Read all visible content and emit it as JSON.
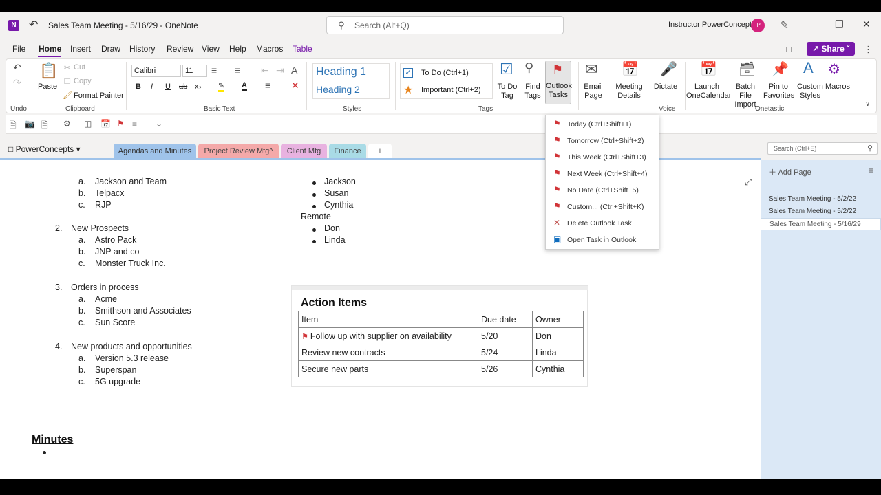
{
  "window": {
    "title": "Sales Team Meeting - 5/16/29  -  OneNote",
    "search_placeholder": "Search (Alt+Q)",
    "user_name": "Instructor PowerConcepts",
    "avatar_initials": "IP"
  },
  "menu": {
    "items": [
      "File",
      "Home",
      "Insert",
      "Draw",
      "History",
      "Review",
      "View",
      "Help",
      "Macros",
      "Table"
    ],
    "active": "Home",
    "share_label": "Share"
  },
  "ribbon": {
    "undo_group": "Undo",
    "clipboard": {
      "paste": "Paste",
      "cut": "Cut",
      "copy": "Copy",
      "format_painter": "Format Painter",
      "group": "Clipboard"
    },
    "basic_text": {
      "font": "Calibri",
      "size": "11",
      "group": "Basic Text"
    },
    "styles": {
      "heading1": "Heading 1",
      "heading2": "Heading 2",
      "group": "Styles"
    },
    "tags": {
      "todo": "To Do (Ctrl+1)",
      "important": "Important (Ctrl+2)",
      "group": "Tags",
      "todo_tag": "To Do Tag",
      "find_tags": "Find Tags",
      "outlook_tasks": "Outlook Tasks"
    },
    "email_page": "Email Page",
    "meeting_details": "Meeting Details",
    "dictate": "Dictate",
    "voice_group": "Voice",
    "onetastic": {
      "launch": "Launch OneCalendar",
      "batch": "Batch File Import",
      "pin": "Pin to Favorites",
      "custom": "Custom Styles",
      "macros": "Macros",
      "group": "Onetastic"
    }
  },
  "notebook": {
    "name": "PowerConcepts",
    "tabs": [
      "Agendas and Minutes",
      "Project Review Mtg^",
      "Client Mtg",
      "Finance",
      "+"
    ],
    "search_placeholder": "Search (Ctrl+E)"
  },
  "outlook_menu": [
    {
      "label": "Today",
      "shortcut": "(Ctrl+Shift+1)",
      "icon": "flag-icon"
    },
    {
      "label": "Tomorrow",
      "shortcut": "(Ctrl+Shift+2)",
      "icon": "flag-icon"
    },
    {
      "label": "This Week",
      "shortcut": "(Ctrl+Shift+3)",
      "icon": "flag-icon"
    },
    {
      "label": "Next Week",
      "shortcut": "(Ctrl+Shift+4)",
      "icon": "flag-icon"
    },
    {
      "label": "No Date",
      "shortcut": "(Ctrl+Shift+5)",
      "icon": "flag-icon"
    },
    {
      "label": "Custom...",
      "shortcut": "(Ctrl+Shift+K)",
      "icon": "flag-icon"
    },
    {
      "label": "Delete Outlook Task",
      "shortcut": "",
      "icon": "delete-x-icon"
    },
    {
      "label": "Open Task in Outlook",
      "shortcut": "",
      "icon": "outlook-icon"
    }
  ],
  "page": {
    "list": [
      {
        "num": "a.",
        "text": "Jackson and Team"
      },
      {
        "num": "b.",
        "text": "Telpacx"
      },
      {
        "num": "c.",
        "text": "RJP"
      },
      {
        "num": "2.",
        "text": "New Prospects"
      },
      {
        "num": "a.",
        "text": "Astro Pack"
      },
      {
        "num": "b.",
        "text": "JNP and co"
      },
      {
        "num": "c.",
        "text": "Monster Truck Inc."
      },
      {
        "num": "3.",
        "text": "Orders in process"
      },
      {
        "num": "a.",
        "text": "Acme"
      },
      {
        "num": "b.",
        "text": "Smithson and Associates"
      },
      {
        "num": "c.",
        "text": "Sun Score"
      },
      {
        "num": "4.",
        "text": "New products and opportunities"
      },
      {
        "num": "a.",
        "text": "Version 5.3 release"
      },
      {
        "num": "b.",
        "text": "Superspan"
      },
      {
        "num": "c.",
        "text": "5G upgrade"
      }
    ],
    "attendees": [
      "Jackson",
      "Susan",
      "Cynthia"
    ],
    "remote_label": "Remote",
    "remote": [
      "Don",
      "Linda"
    ],
    "action_items": {
      "title": "Action Items",
      "headers": [
        "Item",
        "Due date",
        "Owner"
      ],
      "rows": [
        [
          "Follow up with supplier on availability",
          "5/20",
          "Don"
        ],
        [
          "Review new contracts",
          "5/24",
          "Linda"
        ],
        [
          "Secure new parts",
          "5/26",
          "Cynthia"
        ]
      ]
    },
    "minutes_title": "Minutes"
  },
  "pages_panel": {
    "add_page": "Add Page",
    "pages": [
      "Sales Team Meeting - 5/2/22",
      "Sales Team Meeting - 5/2/22",
      "Sales Team Meeting - 5/16/29"
    ]
  },
  "colors": {
    "accent": "#7719aa",
    "flag": "#d13438",
    "heading": "#2e74b5"
  }
}
